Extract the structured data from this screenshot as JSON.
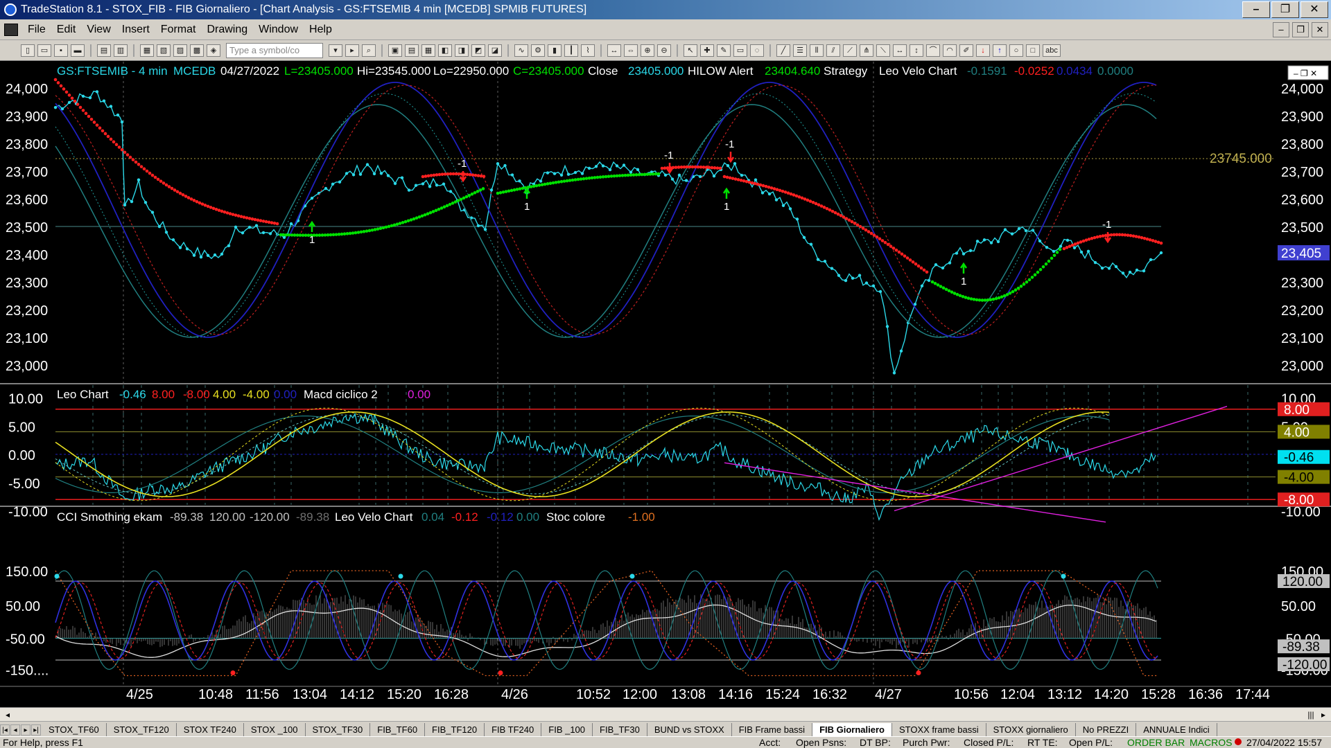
{
  "window": {
    "title": "TradeStation 8.1 - STOX_FIB - FIB Giornaliero - [Chart Analysis - GS:FTSEMIB  4 min  [MCEDB] SPMIB FUTURES]"
  },
  "menu": [
    "File",
    "Edit",
    "View",
    "Insert",
    "Format",
    "Drawing",
    "Window",
    "Help"
  ],
  "toolbar": {
    "symbol_placeholder": "Type a symbol/co",
    "text_tool": "abc"
  },
  "header": {
    "symbol": "GS:FTSEMIB - 4 min",
    "exchange": "MCEDB",
    "date": "04/27/2022",
    "last": "L=23405.000",
    "high": "Hi=23545.000",
    "low": "Lo=22950.000",
    "close_eq": "C=23405.000",
    "close_label": "Close",
    "close_val": "23405.000",
    "hilow_label": "HILOW Alert",
    "hilow_val": "23404.640",
    "strategy": "Strategy",
    "leo_velo": "Leo Velo Chart",
    "v1": "-0.1591",
    "v2": "-0.0252",
    "v3": "0.0434",
    "v4": "0.0000"
  },
  "price_axis": {
    "left": [
      "24,000",
      "23,900",
      "23,800",
      "23,700",
      "23,600",
      "23,500",
      "23,400",
      "23,300",
      "23,200",
      "23,100",
      "23,000"
    ],
    "right": [
      "24,000",
      "23,900",
      "23,800",
      "23,700",
      "23,600",
      "23,500",
      "23,300",
      "23,200",
      "23,100",
      "23,000"
    ],
    "level_line": "23745.000",
    "last_price": "23,405"
  },
  "signals": {
    "minus_one": "-1",
    "one": "1"
  },
  "pane2": {
    "title": "Leo Chart",
    "v1": "-0.46",
    "v2": "8.00",
    "v3": "-8.00",
    "v4": "4.00",
    "v5": "-4.00",
    "v6": "0.00",
    "macd": "Macd ciclico 2",
    "macd_v": "0.00",
    "axis_left": [
      "10.00",
      "5.00",
      "0.00",
      "-5.00",
      "-10.00"
    ],
    "axis_right": [
      "10.00",
      "5.00",
      "-10.00"
    ],
    "badges": [
      "8.00",
      "4.00",
      "-0.46",
      "-4.00",
      "-8.00"
    ]
  },
  "pane3": {
    "title": "CCI Smothing ekam",
    "v1": "-89.38",
    "v2": "120.00",
    "v3": "-120.00",
    "v4": "-89.38",
    "leo": "Leo Velo Chart",
    "l1": "0.04",
    "l2": "-0.12",
    "l3": "-0.12",
    "l4": "0.00",
    "stoc": "Stoc colore",
    "stoc_v": "-1.00",
    "axis_left": [
      "150.00",
      "50.00",
      "-50.00",
      "-150...."
    ],
    "axis_right": [
      "150.00",
      "50.00",
      "-50.00",
      "-150.00"
    ],
    "badges": [
      "120.00",
      "-89.38",
      "-120.00"
    ]
  },
  "time_axis": [
    "4/25",
    "10:48",
    "11:56",
    "13:04",
    "14:12",
    "15:20",
    "16:28",
    "4/26",
    "10:52",
    "12:00",
    "13:08",
    "14:16",
    "15:24",
    "16:32",
    "4/27",
    "10:56",
    "12:04",
    "13:12",
    "14:20",
    "15:28",
    "16:36",
    "17:44"
  ],
  "tabs": [
    "STOX_TF60",
    "STOX_TF120",
    "STOX TF240",
    "STOX _100",
    "STOX_TF30",
    "FIB_TF60",
    "FIB_TF120",
    "FIB TF240",
    "FIB _100",
    "FIB_TF30",
    "BUND vs STOXX",
    "FIB Frame bassi",
    "FIB Giornaliero",
    "STOXX frame bassi",
    "STOXX giornaliero",
    "No PREZZI",
    "ANNUALE Indici"
  ],
  "active_tab": "FIB Giornaliero",
  "status": {
    "help": "For Help, press F1",
    "acct": "Acct:",
    "open_psns": "Open Psns:",
    "dt_bp": "DT BP:",
    "purch_pwr": "Purch Pwr:",
    "closed_pl": "Closed P/L:",
    "rt_te": "RT TE:",
    "open_pl": "Open P/L:",
    "order_bar": "ORDER BAR",
    "macros": "MACROS",
    "datetime": "27/04/2022 15:57"
  },
  "colors": {
    "price": "#2bd8e8",
    "up": "#00e000",
    "down": "#ff2020",
    "blue": "#2020c0",
    "teal": "#207f80",
    "yellow": "#e8e020",
    "magenta": "#e020e0",
    "grid": "#6a6a3a"
  }
}
